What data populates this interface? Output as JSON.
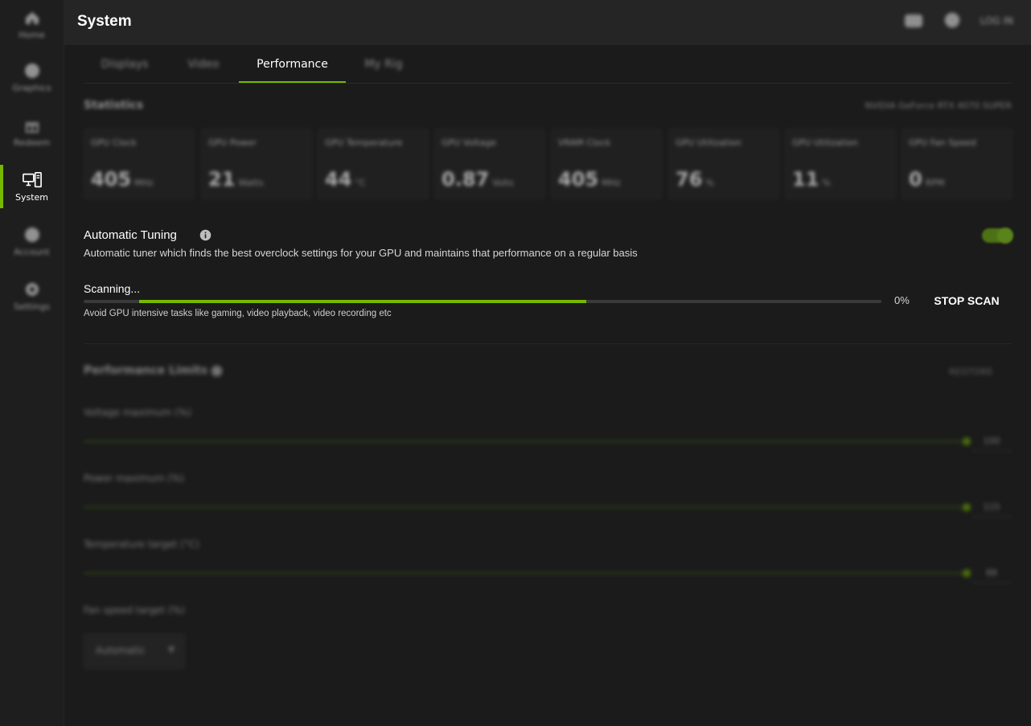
{
  "sidebar": {
    "items": [
      {
        "label": "Home",
        "icon": "home-icon"
      },
      {
        "label": "Graphics",
        "icon": "graphics-icon"
      },
      {
        "label": "Redeem",
        "icon": "gift-icon"
      },
      {
        "label": "System",
        "icon": "system-icon"
      },
      {
        "label": "Account",
        "icon": "account-icon"
      },
      {
        "label": "Settings",
        "icon": "gear-icon"
      }
    ]
  },
  "header": {
    "title": "System",
    "user_label": "LOG IN"
  },
  "tabs": [
    {
      "label": "Displays"
    },
    {
      "label": "Video"
    },
    {
      "label": "Performance"
    },
    {
      "label": "My Rig"
    }
  ],
  "statistics": {
    "title": "Statistics",
    "gpu_name": "NVIDIA GeForce RTX 4070 SUPER",
    "cards": [
      {
        "label": "GPU Clock",
        "value": "405",
        "unit": "MHz"
      },
      {
        "label": "GPU Power",
        "value": "21",
        "unit": "Watts"
      },
      {
        "label": "GPU Temperature",
        "value": "44",
        "unit": "°C"
      },
      {
        "label": "GPU Voltage",
        "value": "0.87",
        "unit": "Volts"
      },
      {
        "label": "VRAM Clock",
        "value": "405",
        "unit": "MHz"
      },
      {
        "label": "GPU Utilization",
        "value": "76",
        "unit": "%"
      },
      {
        "label": "GPU Utilization",
        "value": "11",
        "unit": "%"
      },
      {
        "label": "GPU Fan Speed",
        "value": "0",
        "unit": "RPM"
      }
    ]
  },
  "auto_tuning": {
    "title": "Automatic Tuning",
    "description": "Automatic tuner which finds the best overclock settings for your GPU and maintains that performance on a regular basis",
    "enabled": true,
    "scan_status": "Scanning...",
    "progress_percent_text": "0%",
    "progress_fill_start": 0.07,
    "progress_fill_end": 0.63,
    "stop_label": "STOP SCAN",
    "hint": "Avoid GPU intensive tasks like gaming, video playback, video recording etc"
  },
  "performance_limits": {
    "title": "Performance Limits",
    "restore_label": "RESTORE",
    "sliders": [
      {
        "label": "Voltage maximum (%)",
        "value": "100",
        "fraction": 1.0
      },
      {
        "label": "Power maximum (%)",
        "value": "115",
        "fraction": 1.0
      },
      {
        "label": "Temperature target (°C)",
        "value": "88",
        "fraction": 1.0
      }
    ],
    "fan_label": "Fan speed target (%)",
    "fan_value": "Automatic"
  },
  "colors": {
    "accent": "#76b900",
    "background": "#1b1b1b",
    "header": "#252525"
  }
}
